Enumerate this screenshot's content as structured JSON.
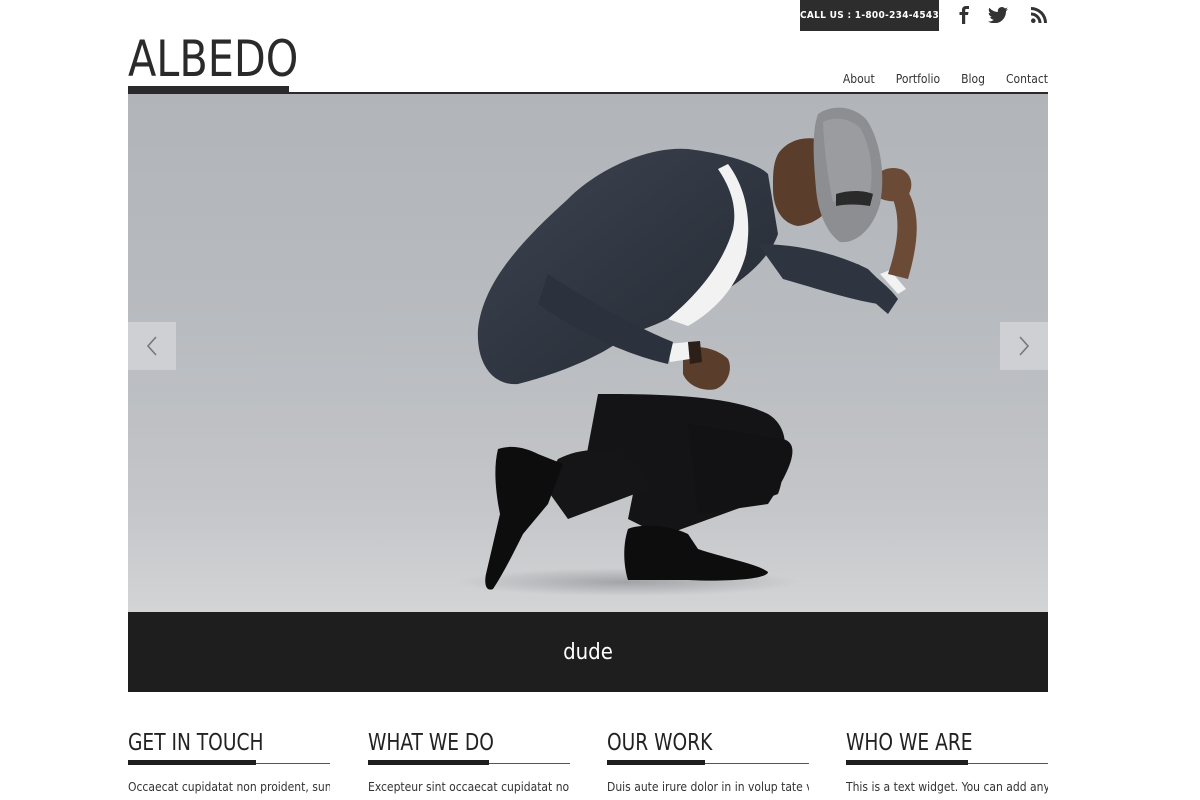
{
  "header": {
    "call_us": "CALL US : 1-800-234-4543",
    "logo": "ALBEDO",
    "social": [
      "facebook-icon",
      "twitter-icon",
      "rss-icon"
    ],
    "nav": [
      "About",
      "Portfolio",
      "Blog",
      "Contact"
    ]
  },
  "slider": {
    "caption": "dude",
    "prev_icon": "chevron-left-icon",
    "next_icon": "chevron-right-icon"
  },
  "widgets": [
    {
      "title": "GET IN TOUCH",
      "text": "Occaecat cupidatat non proident, sunt in"
    },
    {
      "title": "WHAT WE DO",
      "text": "Excepteur sint occaecat cupidatat non"
    },
    {
      "title": "OUR WORK",
      "text": "Duis aute irure dolor in in volup tate velit"
    },
    {
      "title": "WHO WE ARE",
      "text": "This is a text widget. You can add any"
    }
  ],
  "colors": {
    "dark": "#1e1e1e",
    "accent_bar": "#2d2d2d",
    "slide_bg": "#b8bbbf"
  }
}
